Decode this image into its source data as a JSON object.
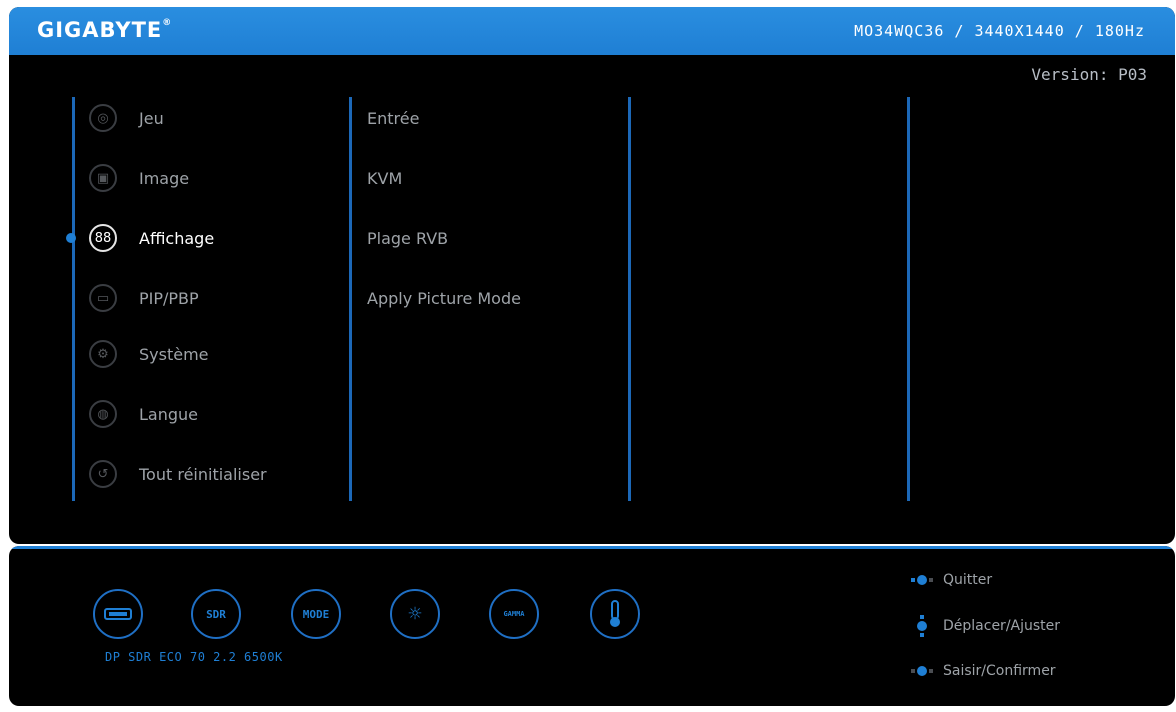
{
  "header": {
    "brand": "GIGABYTE",
    "model_info": "MO34WQC36 / 3440X1440 / 180Hz",
    "version": "Version: P03"
  },
  "menu": {
    "items": [
      {
        "label": "Jeu",
        "icon": "gamepad-icon"
      },
      {
        "label": "Image",
        "icon": "picture-icon"
      },
      {
        "label": "Affichage",
        "icon": "display-grid-icon",
        "active": true
      },
      {
        "label": "PIP/PBP",
        "icon": "pip-icon"
      },
      {
        "label": "Système",
        "icon": "settings-icon"
      },
      {
        "label": "Langue",
        "icon": "globe-icon"
      },
      {
        "label": "Tout réinitialiser",
        "icon": "reset-icon"
      }
    ]
  },
  "submenu": {
    "items": [
      "Entrée",
      "KVM",
      "Plage RVB",
      "Apply Picture Mode"
    ]
  },
  "status": {
    "icons": [
      {
        "name": "displayport-icon",
        "text": ""
      },
      {
        "name": "sdr-icon",
        "text": "SDR"
      },
      {
        "name": "mode-icon",
        "text": "MODE"
      },
      {
        "name": "brightness-icon",
        "text": ""
      },
      {
        "name": "gamma-icon",
        "text": "GAMMA"
      },
      {
        "name": "color-temperature-icon",
        "text": ""
      }
    ],
    "summary": "DP SDR ECO 70 2.2 6500K"
  },
  "hints": [
    {
      "label": "Quitter",
      "icon": "joystick-left-icon"
    },
    {
      "label": "Déplacer/Ajuster",
      "icon": "joystick-updown-icon"
    },
    {
      "label": "Saisir/Confirmer",
      "icon": "joystick-press-icon"
    }
  ],
  "colors": {
    "accent": "#1f7fd4",
    "background": "#000000"
  }
}
